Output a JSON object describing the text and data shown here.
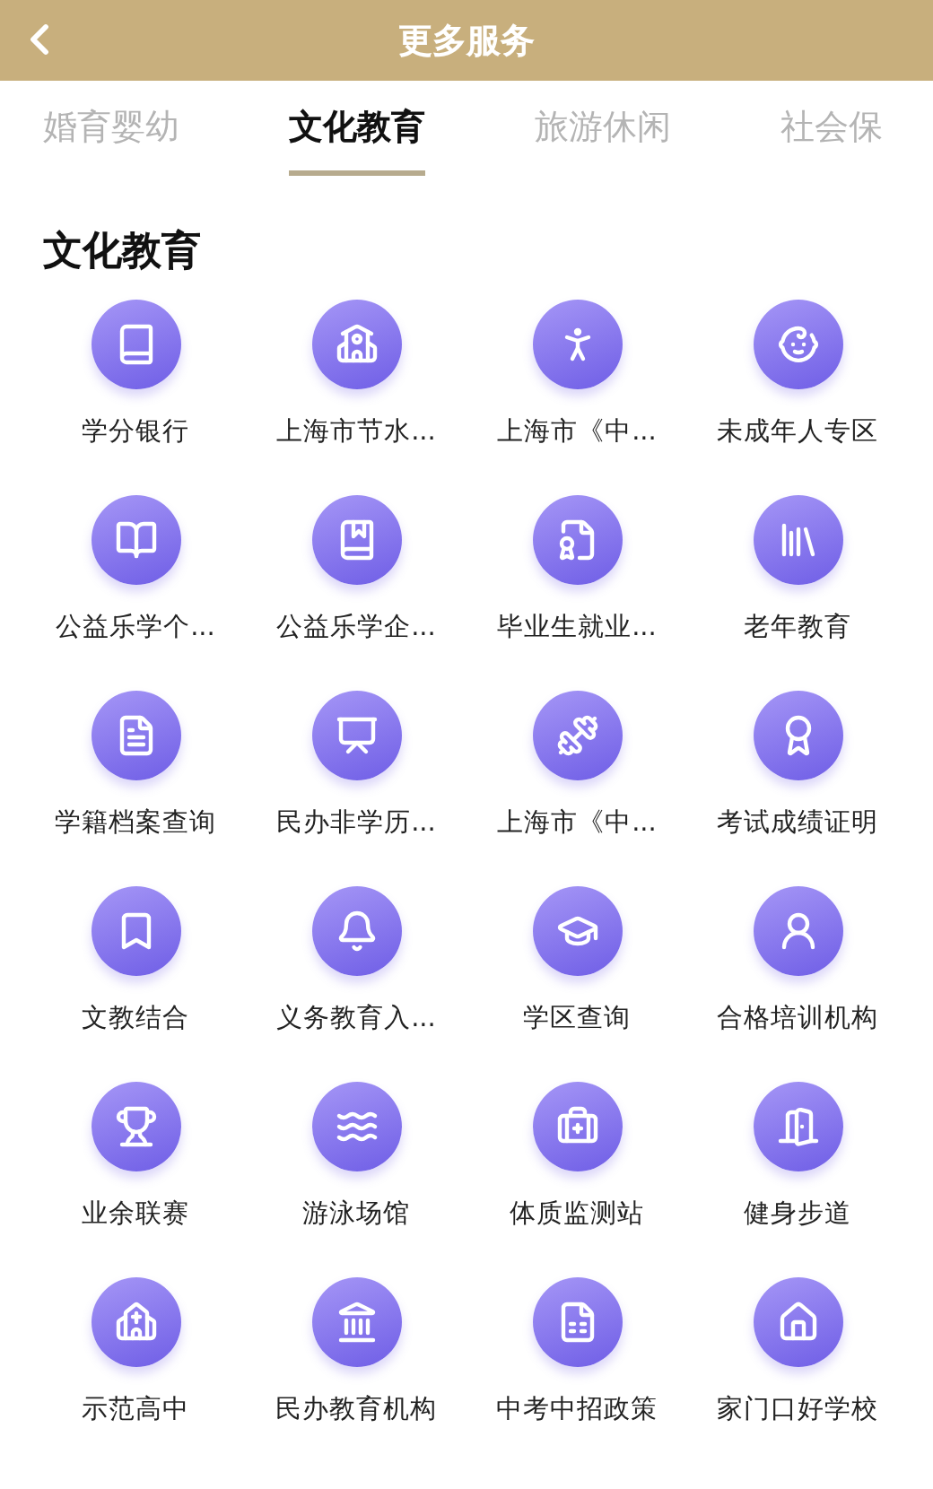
{
  "header": {
    "title": "更多服务"
  },
  "tabs": [
    {
      "label": "婚育婴幼",
      "selected": false
    },
    {
      "label": "文化教育",
      "selected": true
    },
    {
      "label": "旅游休闲",
      "selected": false
    },
    {
      "label": "社会保",
      "selected": false
    }
  ],
  "section": {
    "title": "文化教育"
  },
  "services": [
    {
      "label": "学分银行"
    },
    {
      "label": "上海市节水..."
    },
    {
      "label": "上海市《中..."
    },
    {
      "label": "未成年人专区"
    },
    {
      "label": "公益乐学个..."
    },
    {
      "label": "公益乐学企..."
    },
    {
      "label": "毕业生就业..."
    },
    {
      "label": "老年教育"
    },
    {
      "label": "学籍档案查询"
    },
    {
      "label": "民办非学历..."
    },
    {
      "label": "上海市《中..."
    },
    {
      "label": "考试成绩证明"
    },
    {
      "label": "文教结合"
    },
    {
      "label": "义务教育入..."
    },
    {
      "label": "学区查询"
    },
    {
      "label": "合格培训机构"
    },
    {
      "label": "业余联赛"
    },
    {
      "label": "游泳场馆"
    },
    {
      "label": "体质监测站"
    },
    {
      "label": "健身步道"
    },
    {
      "label": "示范高中"
    },
    {
      "label": "民办教育机构"
    },
    {
      "label": "中考中招政策"
    },
    {
      "label": "家门口好学校"
    }
  ]
}
